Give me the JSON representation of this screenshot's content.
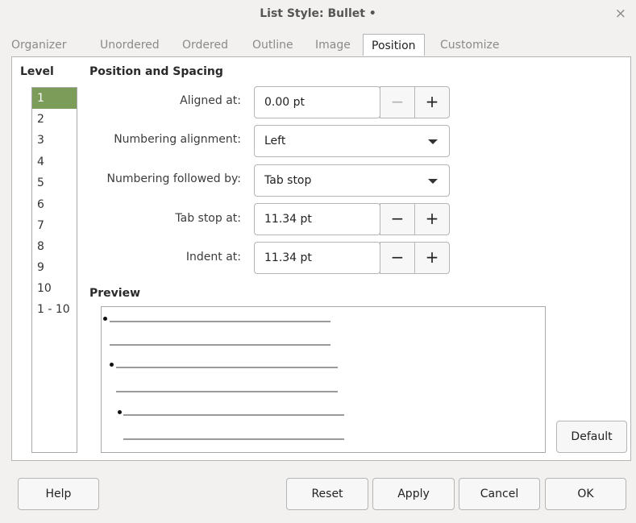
{
  "window": {
    "title": "List Style: Bullet •",
    "close_glyph": "×"
  },
  "tabs": [
    "Organizer",
    "Unordered",
    "Ordered",
    "Outline",
    "Image",
    "Position",
    "Customize"
  ],
  "active_tab": "Position",
  "level": {
    "label": "Level",
    "items": [
      "1",
      "2",
      "3",
      "4",
      "5",
      "6",
      "7",
      "8",
      "9",
      "10",
      "1 - 10"
    ],
    "selected": "1"
  },
  "position": {
    "title": "Position and Spacing",
    "aligned_at": {
      "label": "Aligned at:",
      "value": "0.00 pt"
    },
    "numbering_alignment": {
      "label": "Numbering alignment:",
      "value": "Left"
    },
    "numbering_followed_by": {
      "label": "Numbering followed by:",
      "value": "Tab stop"
    },
    "tab_stop_at": {
      "label": "Tab stop at:",
      "value": "11.34 pt"
    },
    "indent_at": {
      "label": "Indent at:",
      "value": "11.34 pt"
    },
    "minus": "−",
    "plus": "+"
  },
  "preview": {
    "title": "Preview",
    "bullet_glyph": "•"
  },
  "buttons": {
    "default": "Default",
    "help": "Help",
    "reset": "Reset",
    "apply": "Apply",
    "cancel": "Cancel",
    "ok": "OK"
  },
  "colors": {
    "selection": "#7c9c5a",
    "background": "#f2f1f0"
  }
}
